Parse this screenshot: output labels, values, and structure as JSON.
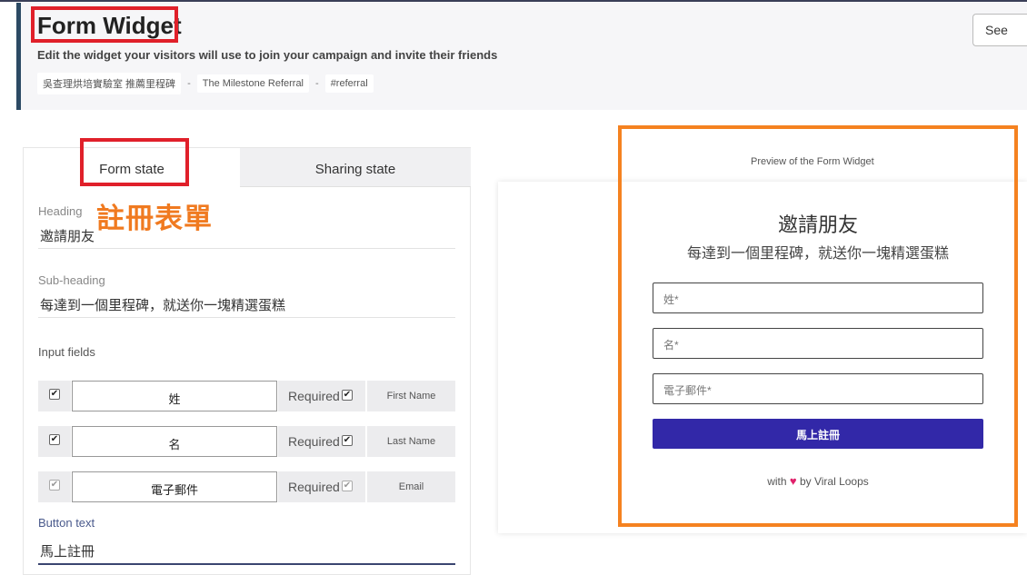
{
  "header": {
    "title": "Form Widget",
    "description": "Edit the widget your visitors will use to join your campaign and invite their friends",
    "breadcrumbs": [
      "吳查理烘培實驗室 推薦里程碑",
      "The Milestone Referral",
      "#referral"
    ],
    "separator": "-",
    "see_button": "See"
  },
  "tabs": {
    "form_state": "Form state",
    "sharing_state": "Sharing state"
  },
  "annotation": "註冊表單",
  "form": {
    "heading_label": "Heading",
    "heading_value": "邀請朋友",
    "subheading_label": "Sub-heading",
    "subheading_value": "每達到一個里程碑，就送你一塊精選蛋糕",
    "input_fields_label": "Input fields",
    "fields": [
      {
        "enabled": true,
        "label": "姓",
        "required_label": "Required",
        "required": true,
        "name": "First Name"
      },
      {
        "enabled": true,
        "label": "名",
        "required_label": "Required",
        "required": true,
        "name": "Last Name"
      },
      {
        "enabled": true,
        "label": "電子郵件",
        "required_label": "Required",
        "required": true,
        "name": "Email"
      }
    ],
    "button_text_label": "Button text",
    "button_text_value": "馬上註冊"
  },
  "preview": {
    "caption": "Preview of the Form Widget",
    "heading": "邀請朋友",
    "subheading": "每達到一個里程碑，就送你一塊精選蛋糕",
    "placeholders": [
      "姓*",
      "名*",
      "電子郵件*"
    ],
    "button": "馬上註冊",
    "footer_with": "with",
    "footer_by": "by Viral Loops"
  },
  "colors": {
    "highlight_red": "#e0202a",
    "highlight_orange": "#f58220",
    "button_bg": "#3228a8",
    "heart": "#e0216b"
  }
}
